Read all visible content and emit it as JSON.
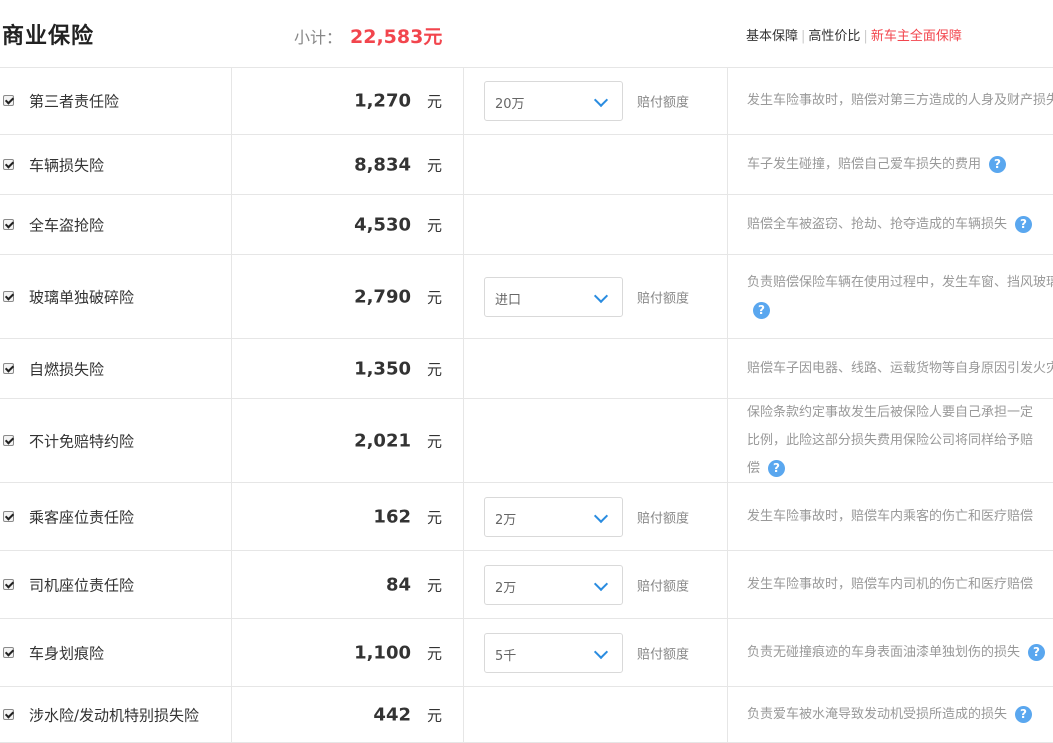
{
  "header": {
    "title": "商业保险",
    "subtotal_label": "小计：",
    "subtotal_value": "22,583",
    "subtotal_unit": "元",
    "tabs": [
      "基本保障",
      "高性价比",
      "新车主全面保障"
    ],
    "tab_separator": "|"
  },
  "currency_unit": "元",
  "help_glyph": "?",
  "colors": {
    "accent_red": "#f2454d",
    "help_blue": "#5aa7ef",
    "chevron_blue": "#2a8ce0"
  },
  "rows": [
    {
      "name": "第三者责任险",
      "price": "1,270",
      "select": "20万",
      "option_label": "赔付额度",
      "desc": "发生车险事故时，赔偿对第三方造成的人身及财产损失"
    },
    {
      "name": "车辆损失险",
      "price": "8,834",
      "desc": "车子发生碰撞，赔偿自己爱车损失的费用"
    },
    {
      "name": "全车盗抢险",
      "price": "4,530",
      "desc": "赔偿全车被盗窃、抢劫、抢夺造成的车辆损失"
    },
    {
      "name": "玻璃单独破碎险",
      "price": "2,790",
      "select": "进口",
      "option_label": "赔付额度",
      "desc": "负责赔偿保险车辆在使用过程中，发生车窗、挡风玻璃"
    },
    {
      "name": "自燃损失险",
      "price": "1,350",
      "desc": "赔偿车子因电器、线路、运载货物等自身原因引发火灾"
    },
    {
      "name": "不计免赔特约险",
      "price": "2,021",
      "desc": "保险条款约定事故发生后被保险人要自己承担一定比例，此险这部分损失费用保险公司将同样给予赔偿"
    },
    {
      "name": "乘客座位责任险",
      "price": "162",
      "select": "2万",
      "option_label": "赔付额度",
      "desc": "发生车险事故时，赔偿车内乘客的伤亡和医疗赔偿"
    },
    {
      "name": "司机座位责任险",
      "price": "84",
      "select": "2万",
      "option_label": "赔付额度",
      "desc": "发生车险事故时，赔偿车内司机的伤亡和医疗赔偿"
    },
    {
      "name": "车身划痕险",
      "price": "1,100",
      "select": "5千",
      "option_label": "赔付额度",
      "desc": "负责无碰撞痕迹的车身表面油漆单独划伤的损失"
    },
    {
      "name": "涉水险/发动机特别损失险",
      "price": "442",
      "desc": "负责爱车被水淹导致发动机受损所造成的损失"
    }
  ]
}
